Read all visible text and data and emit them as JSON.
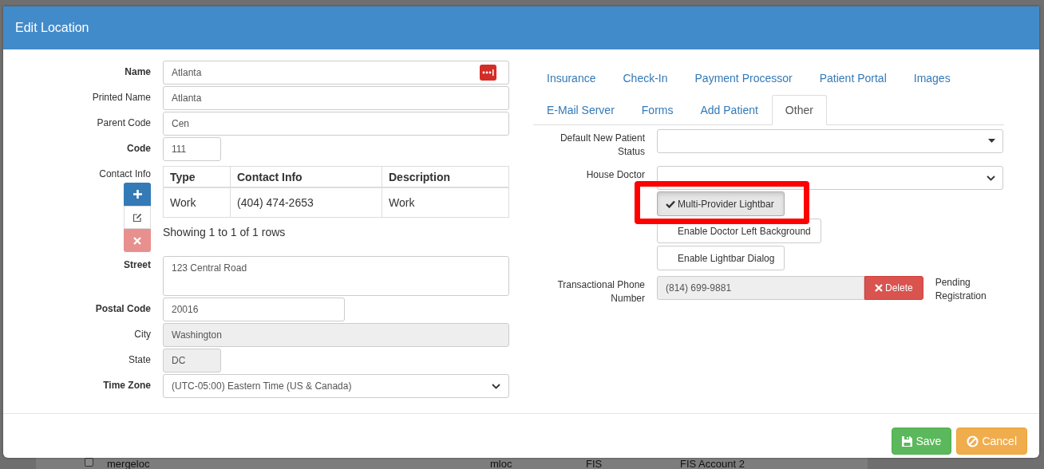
{
  "window": {
    "title": "Edit Location"
  },
  "background_row": {
    "checked": false,
    "cells": [
      "mergeloc",
      "mloc",
      "FIS",
      "FIS Account 2"
    ]
  },
  "left_form": [
    {
      "label": "Name",
      "required": true,
      "kind": "text",
      "value": "Atlanta",
      "disabled": false
    },
    {
      "label": "Printed Name",
      "required": false,
      "kind": "text",
      "value": "Atlanta",
      "disabled": false
    },
    {
      "label": "Parent Code",
      "required": false,
      "kind": "text",
      "value": "Cen",
      "disabled": false
    },
    {
      "label": "Code",
      "required": true,
      "kind": "text",
      "value": "111",
      "disabled": false
    },
    {
      "label": "Contact Info",
      "required": false,
      "kind": "contacts",
      "columns": [
        "Type",
        "Contact Info",
        "Description"
      ],
      "rows": [
        [
          "Work",
          "(404) 474-2653",
          "Work"
        ]
      ],
      "summary": "Showing 1 to 1 of 1 rows"
    },
    {
      "label": "Street",
      "required": true,
      "kind": "textarea",
      "value": "123 Central Road"
    },
    {
      "label": "Postal Code",
      "required": true,
      "kind": "text",
      "value": "20016",
      "disabled": false
    },
    {
      "label": "City",
      "required": false,
      "kind": "text",
      "value": "Washington",
      "disabled": true
    },
    {
      "label": "State",
      "required": false,
      "kind": "text",
      "value": "DC",
      "disabled": true
    },
    {
      "label": "Time Zone",
      "required": true,
      "kind": "select",
      "value": "(UTC-05:00) Eastern Time (US & Canada)"
    }
  ],
  "tab_rows": [
    [
      {
        "label": "Insurance",
        "selected": false
      },
      {
        "label": "Check-In",
        "selected": false
      },
      {
        "label": "Payment Processor",
        "selected": false
      },
      {
        "label": "Patient Portal",
        "selected": false
      },
      {
        "label": "Images",
        "selected": false
      }
    ],
    [
      {
        "label": "E-Mail Server",
        "selected": false
      },
      {
        "label": "Forms",
        "selected": false
      },
      {
        "label": "Add Patient",
        "selected": false
      },
      {
        "label": "Other",
        "selected": true
      }
    ]
  ],
  "other_form": [
    {
      "label": "Default New Patient Status",
      "kind": "dropdown"
    },
    {
      "label": "House Doctor",
      "kind": "select"
    },
    {
      "kind": "toggles",
      "options": [
        {
          "label": "Multi-Provider Lightbar",
          "selected": true
        },
        {
          "label": "Enable Doctor Left Background",
          "selected": false
        },
        {
          "label": "Enable Lightbar Dialog",
          "selected": false
        }
      ]
    },
    {
      "label": "Transactional Phone Number",
      "kind": "phone",
      "value": "(814) 699-9881",
      "button": "Delete",
      "status": "Pending Registration"
    }
  ],
  "footer_buttons": [
    {
      "label": "Save",
      "kind": "save"
    },
    {
      "label": "Cancel",
      "kind": "cancel"
    }
  ]
}
